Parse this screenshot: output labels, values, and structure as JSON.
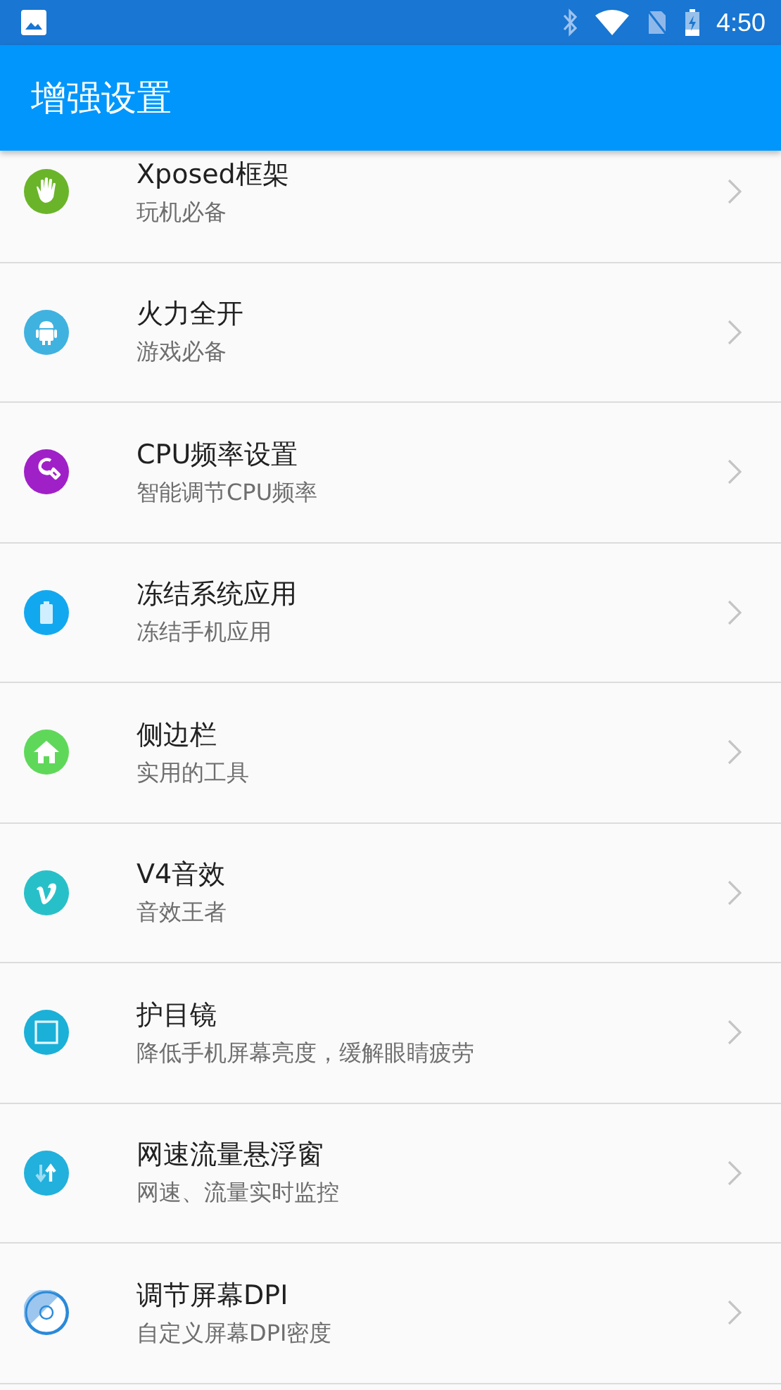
{
  "status_bar": {
    "time": "4:50"
  },
  "app_bar": {
    "title": "增强设置"
  },
  "items": [
    {
      "title": "Xposed框架",
      "subtitle": "玩机必备",
      "kind": "hand",
      "color": "#6ab42a"
    },
    {
      "title": "火力全开",
      "subtitle": "游戏必备",
      "kind": "android",
      "color": "#3fb2e0"
    },
    {
      "title": "CPU频率设置",
      "subtitle": "智能调节CPU频率",
      "kind": "wrench",
      "color": "#a020c8"
    },
    {
      "title": "冻结系统应用",
      "subtitle": "冻结手机应用",
      "kind": "battery",
      "color": "#12a8f0"
    },
    {
      "title": "侧边栏",
      "subtitle": "实用的工具",
      "kind": "home",
      "color": "#5fd85a"
    },
    {
      "title": "V4音效",
      "subtitle": "音效王者",
      "kind": "vimeo",
      "color": "#28c0c8"
    },
    {
      "title": "护目镜",
      "subtitle": "降低手机屏幕亮度，缓解眼睛疲劳",
      "kind": "square",
      "color": "#1ab0d8"
    },
    {
      "title": "网速流量悬浮窗",
      "subtitle": "网速、流量实时监控",
      "kind": "arrows",
      "color": "#22b0dc"
    },
    {
      "title": "调节屏幕DPI",
      "subtitle": "自定义屏幕DPI密度",
      "kind": "disc",
      "color": "#2a8ad8"
    }
  ]
}
